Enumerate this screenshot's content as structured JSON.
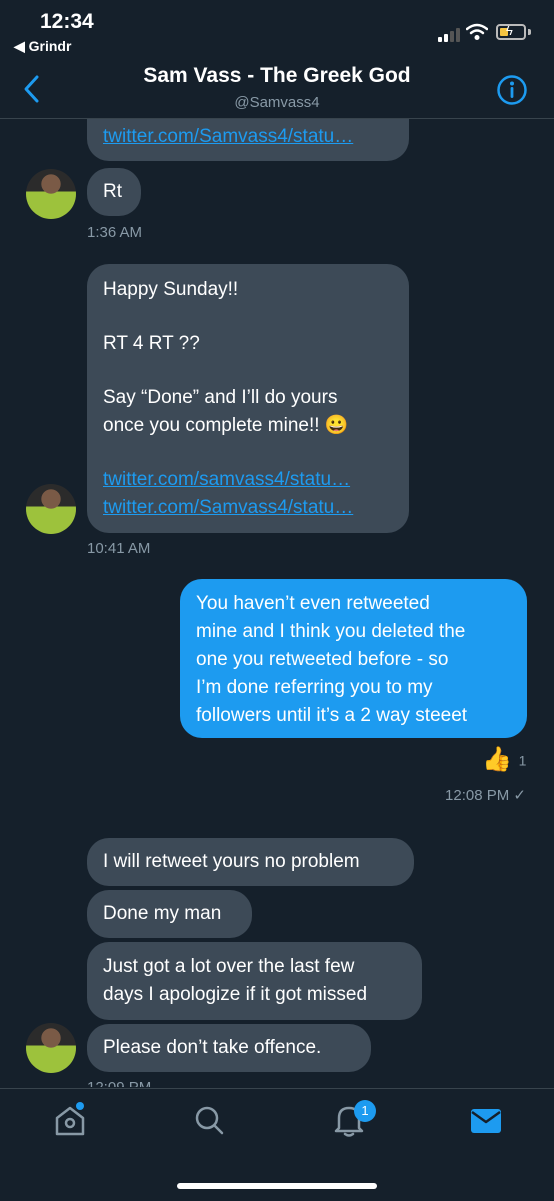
{
  "status_bar": {
    "time": "12:34",
    "back_app": "◀ Grindr"
  },
  "header": {
    "title": "Sam Vass - The Greek God",
    "handle": "@Samvass4"
  },
  "conversation": {
    "top_partial_link": "twitter.com/Samvass4/statu…",
    "messages": [
      {
        "text": "Rt",
        "time": "1:36 AM"
      },
      {
        "lines": [
          "Happy Sunday!!",
          "RT 4 RT ??",
          "Say “Done” and I’ll do yours",
          "once you complete mine!! 😀"
        ],
        "links": [
          "twitter.com/samvass4/statu…",
          "twitter.com/Samvass4/statu…"
        ],
        "time": "10:41 AM"
      },
      {
        "lines": [
          "You haven’t even retweeted",
          "mine and I think you deleted the",
          "one you retweeted before - so",
          "I’m done referring you to my",
          "followers until it’s a 2 way steeet"
        ],
        "reaction": "👍",
        "reaction_count": "1",
        "time": "12:08 PM ✓"
      },
      {
        "text": "I will retweet yours no problem"
      },
      {
        "text": "Done my man"
      },
      {
        "lines": [
          "Just got a lot over the last few",
          "days I apologize if it got missed"
        ]
      },
      {
        "text": "Please don’t take offence.",
        "time": "12:09 PM"
      }
    ]
  },
  "tab_bar": {
    "notifications_badge": "1"
  },
  "colors": {
    "background": "#15202b",
    "incoming_bubble": "#3d4a57",
    "outgoing_bubble": "#1d9bf0",
    "accent": "#1d9bf0"
  }
}
